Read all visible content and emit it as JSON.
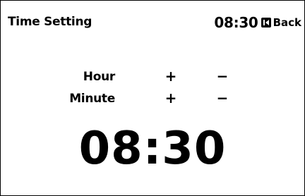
{
  "header": {
    "title": "Time Setting",
    "current_time": "08:30",
    "back_icon": "back-icon",
    "back_label": "Back"
  },
  "settings": {
    "hour": {
      "label": "Hour",
      "increment_label": "+",
      "decrement_label": "−"
    },
    "minute": {
      "label": "Minute",
      "increment_label": "+",
      "decrement_label": "−"
    }
  },
  "display": {
    "time": "08:30"
  }
}
